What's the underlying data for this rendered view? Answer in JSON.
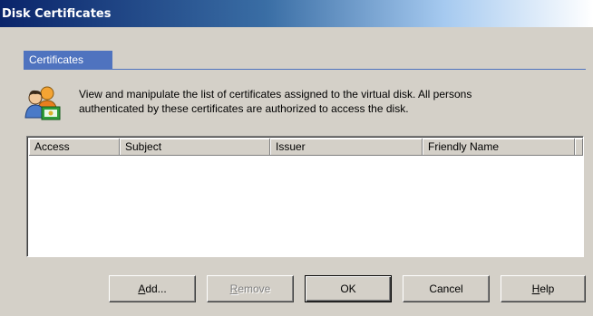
{
  "window": {
    "title": "Disk Certificates"
  },
  "tabs": [
    {
      "label": "Certificates"
    }
  ],
  "description": {
    "line1": "View and manipulate the list of certificates assigned to the virtual disk. All persons",
    "line2": "authenticated by these certificates are authorized to access the disk.",
    "icon": "users-certificate-icon"
  },
  "table": {
    "columns": [
      "Access",
      "Subject",
      "Issuer",
      "Friendly Name"
    ],
    "rows": []
  },
  "buttons": {
    "add": {
      "mnemonic": "A",
      "rest": "dd..."
    },
    "remove": {
      "mnemonic": "R",
      "rest": "emove",
      "disabled": true
    },
    "ok": {
      "label": "OK"
    },
    "cancel": {
      "label": "Cancel"
    },
    "help": {
      "mnemonic": "H",
      "rest": "elp"
    }
  },
  "colors": {
    "tab": "#4f73bf",
    "title_start": "#0a246a",
    "dialog_bg": "#d4d0c8"
  }
}
